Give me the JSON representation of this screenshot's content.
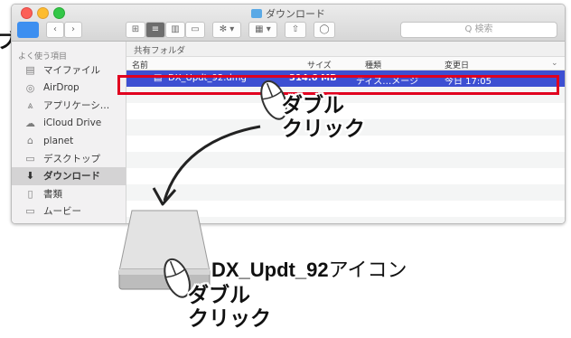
{
  "window": {
    "title": "ダウンロード",
    "search_placeholder": "Q 検索",
    "path": "共有フォルダ"
  },
  "sidebar": {
    "section_label": "よく使う項目",
    "items": [
      {
        "icon": "document-icon",
        "label": "マイファイル"
      },
      {
        "icon": "airdrop-icon",
        "label": "AirDrop"
      },
      {
        "icon": "applications-icon",
        "label": "アプリケーシ…"
      },
      {
        "icon": "cloud-icon",
        "label": "iCloud Drive"
      },
      {
        "icon": "home-icon",
        "label": "planet"
      },
      {
        "icon": "desktop-icon",
        "label": "デスクトップ"
      },
      {
        "icon": "download-icon",
        "label": "ダウンロード",
        "selected": true
      },
      {
        "icon": "documents-icon",
        "label": "書類"
      },
      {
        "icon": "movies-icon",
        "label": "ムービー"
      }
    ]
  },
  "columns": {
    "name": "名前",
    "size": "サイズ",
    "kind": "種類",
    "modified": "変更日"
  },
  "files": [
    {
      "name": "DX_Updt_92.dmg",
      "size": "314.6 MB",
      "kind": "ディス…メージ",
      "modified": "今日 17:05",
      "selected": true
    }
  ],
  "annotations": {
    "double_click_line1": "ダブル",
    "double_click_line2": "クリック",
    "disk_caption_name": "DX_Updt_92",
    "disk_caption_suffix": "アイコン",
    "edge_char": "ブ"
  },
  "colors": {
    "selection": "#3d4fd2",
    "highlight_box": "#e1001f",
    "sidebar_toggle": "#3d8ff0"
  }
}
